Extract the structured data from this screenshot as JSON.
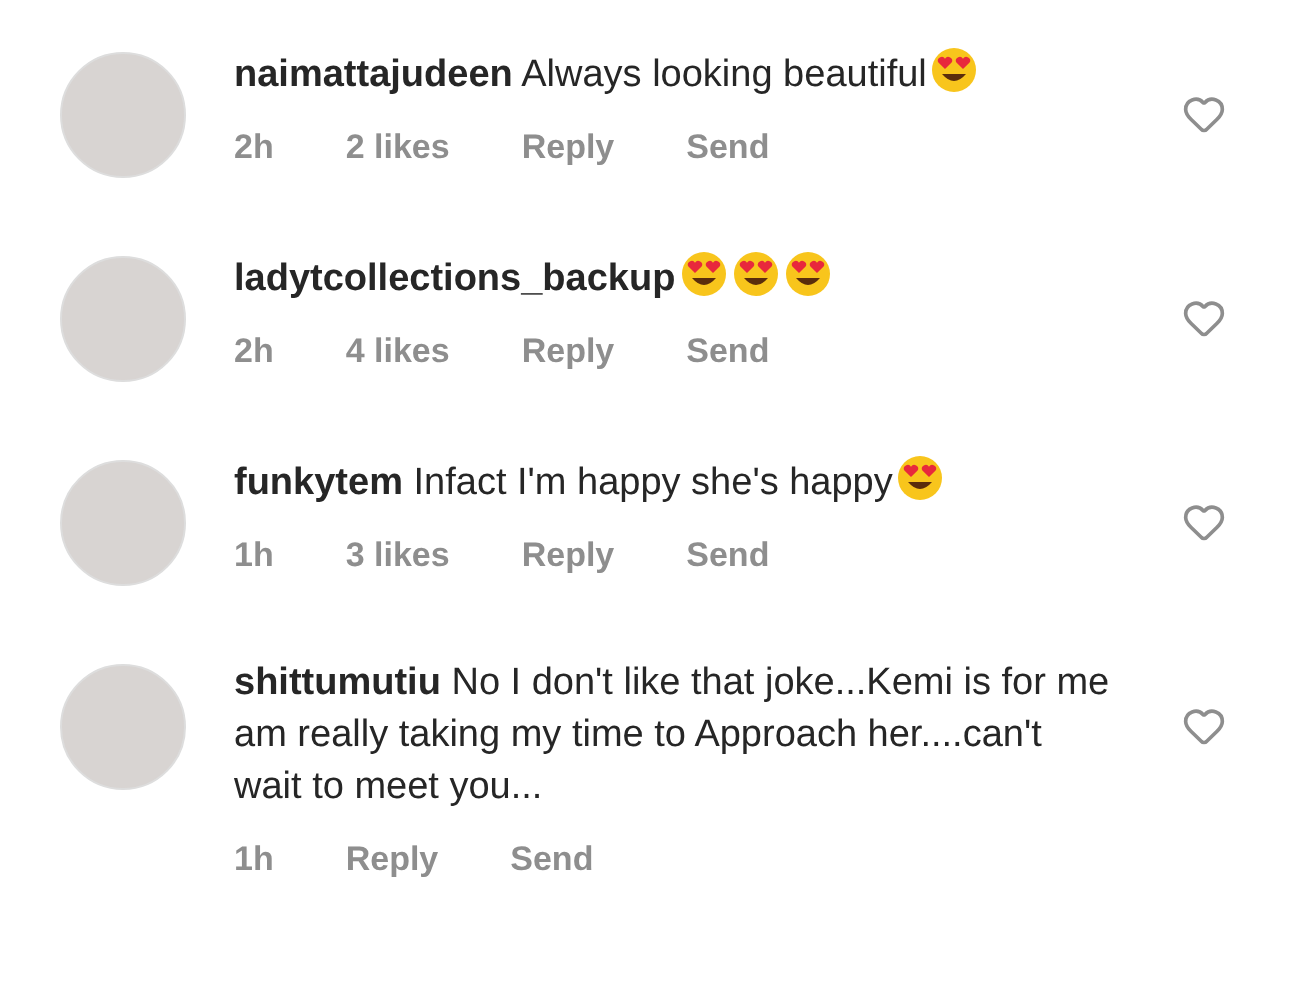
{
  "comments": [
    {
      "username": "naimattajudeen",
      "text": "Always looking beautiful",
      "emojis": [
        {
          "kind": "heart-eyes"
        }
      ],
      "time": "2h",
      "likes": "2 likes",
      "reply": "Reply",
      "send": "Send"
    },
    {
      "username": "ladytcollections_backup",
      "emojis": [
        {
          "kind": "heart-eyes"
        },
        {
          "kind": "heart-eyes"
        },
        {
          "kind": "heart-eyes"
        }
      ],
      "time": "2h",
      "likes": "4 likes",
      "reply": "Reply",
      "send": "Send"
    },
    {
      "username": "funkytem",
      "text": "Infact I'm happy she's happy",
      "emojis": [
        {
          "kind": "heart-eyes"
        }
      ],
      "time": "1h",
      "likes": "3 likes",
      "reply": "Reply",
      "send": "Send"
    },
    {
      "username": "shittumutiu",
      "text": "No I don't like that joke...Kemi is for me am really taking my time to Approach her....can't wait to meet you...",
      "time": "1h",
      "reply": "Reply",
      "send": "Send"
    }
  ]
}
